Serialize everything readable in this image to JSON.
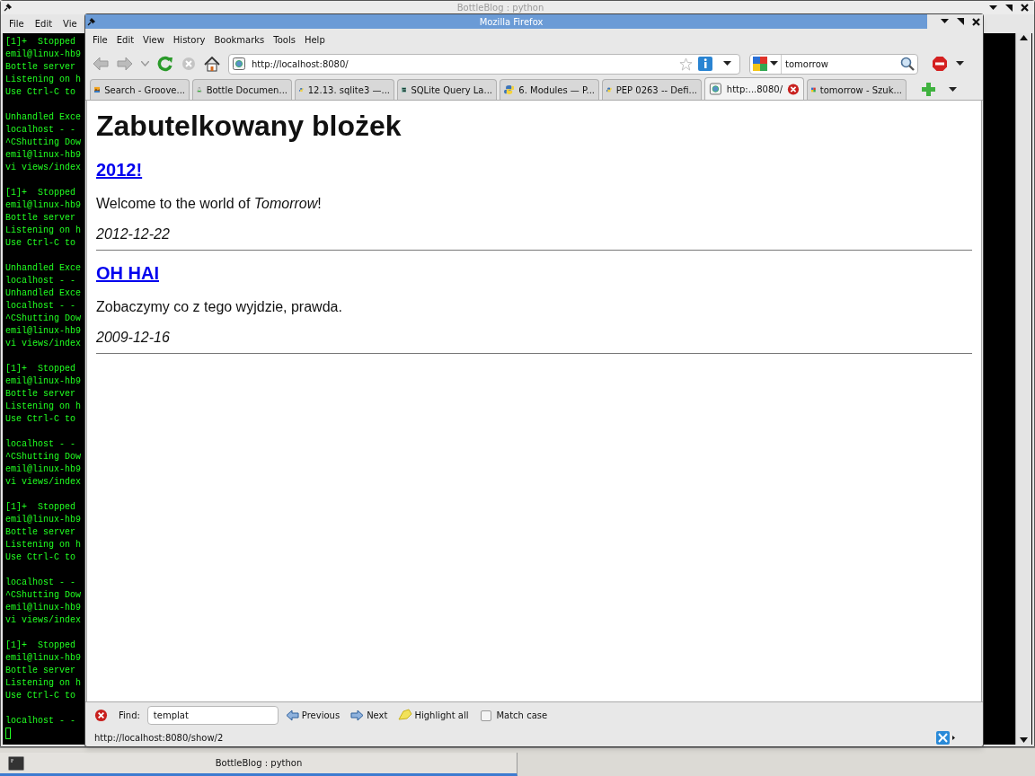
{
  "terminal_window": {
    "title": "BottleBlog : python",
    "menu": [
      "File",
      "Edit",
      "Vie"
    ],
    "output_blocks": [
      [
        "[1]+  Stopped",
        "emil@linux-hb9",
        "Bottle server",
        "Listening on h",
        "Use Ctrl-C to"
      ],
      [
        "Unhandled Exce",
        "localhost - -",
        "^CShutting Dow",
        "emil@linux-hb9",
        "vi views/index"
      ],
      [
        "[1]+  Stopped",
        "emil@linux-hb9",
        "Bottle server",
        "Listening on h",
        "Use Ctrl-C to"
      ],
      [
        "Unhandled Exce",
        "localhost - -",
        "Unhandled Exce",
        "localhost - -",
        "^CShutting Dow",
        "emil@linux-hb9",
        "vi views/index"
      ],
      [
        "[1]+  Stopped",
        "emil@linux-hb9",
        "Bottle server",
        "Listening on h",
        "Use Ctrl-C to"
      ],
      [
        "localhost - -",
        "^CShutting Dow",
        "emil@linux-hb9",
        "vi views/index"
      ],
      [
        "[1]+  Stopped",
        "emil@linux-hb9",
        "Bottle server",
        "Listening on h",
        "Use Ctrl-C to"
      ],
      [
        "localhost - -",
        "^CShutting Dow",
        "emil@linux-hb9",
        "vi views/index"
      ],
      [
        "[1]+  Stopped",
        "emil@linux-hb9",
        "Bottle server",
        "Listening on h",
        "Use Ctrl-C to"
      ],
      [
        "localhost - -"
      ]
    ]
  },
  "browser": {
    "title": "Mozilla Firefox",
    "menu": [
      "File",
      "Edit",
      "View",
      "History",
      "Bookmarks",
      "Tools",
      "Help"
    ],
    "url": "http://localhost:8080/",
    "search": {
      "value": "tomorrow"
    },
    "tabs": [
      {
        "label": "Search - Groove...",
        "kind": "picture",
        "selected": false
      },
      {
        "label": "Bottle Documen...",
        "kind": "flask",
        "selected": false
      },
      {
        "label": "12.13. sqlite3 —...",
        "kind": "python",
        "selected": false
      },
      {
        "label": "SQLite Query La...",
        "kind": "sqlite",
        "selected": false
      },
      {
        "label": "6. Modules — P...",
        "kind": "python",
        "selected": false
      },
      {
        "label": "PEP 0263 -- Defi...",
        "kind": "python",
        "selected": false
      },
      {
        "label": "http:...8080/",
        "kind": "page",
        "selected": true
      },
      {
        "label": "tomorrow - Szuk...",
        "kind": "google",
        "selected": false
      }
    ],
    "page": {
      "heading": "Zabutelkowany blożek",
      "posts": [
        {
          "title": "2012!",
          "body": "Welcome to the world of *Tomorrow*!",
          "date": "2012-12-22"
        },
        {
          "title": "OH HAI",
          "body": "Zobaczymy co z tego wyjdzie, prawda.",
          "date": "2009-12-16"
        }
      ]
    },
    "find_bar": {
      "label": "Find:",
      "value": "templat",
      "previous": "Previous",
      "next": "Next",
      "highlight_all": "Highlight all",
      "match_case": {
        "label": "Match case",
        "checked": false
      }
    },
    "status_bar": "http://localhost:8080/show/2"
  },
  "taskbar": {
    "items": [
      {
        "label": "BottleBlog : python",
        "selected": true
      }
    ]
  }
}
